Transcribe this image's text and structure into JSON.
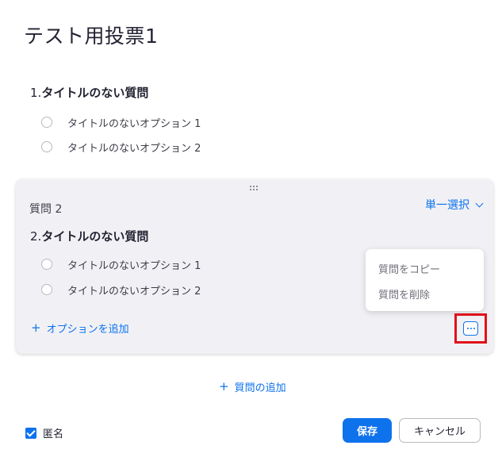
{
  "poll": {
    "title": "テスト用投票1"
  },
  "question1": {
    "number": "1.",
    "title": "タイトルのない質問",
    "options": [
      "タイトルのないオプション 1",
      "タイトルのないオプション 2"
    ]
  },
  "question2": {
    "label": "質問 2",
    "type_select": "単一選択",
    "number": "2.",
    "title": "タイトルのない質問",
    "options": [
      "タイトルのないオプション 1",
      "タイトルのないオプション 2"
    ],
    "add_option": "オプションを追加",
    "menu": {
      "copy": "質問をコピー",
      "delete": "質問を削除"
    }
  },
  "footer": {
    "add_question": "質問の追加",
    "anonymous_label": "匿名",
    "anonymous_checked": true,
    "save": "保存",
    "cancel": "キャンセル"
  },
  "icons": {
    "drag": "drag-handle-icon",
    "chevron": "chevron-down-icon",
    "more": "more-horizontal-icon",
    "plus": "plus-icon",
    "check": "checkmark-icon"
  },
  "colors": {
    "accent": "#0e72ed",
    "highlight": "#e0101a",
    "card_bg": "#f1f1f5"
  }
}
